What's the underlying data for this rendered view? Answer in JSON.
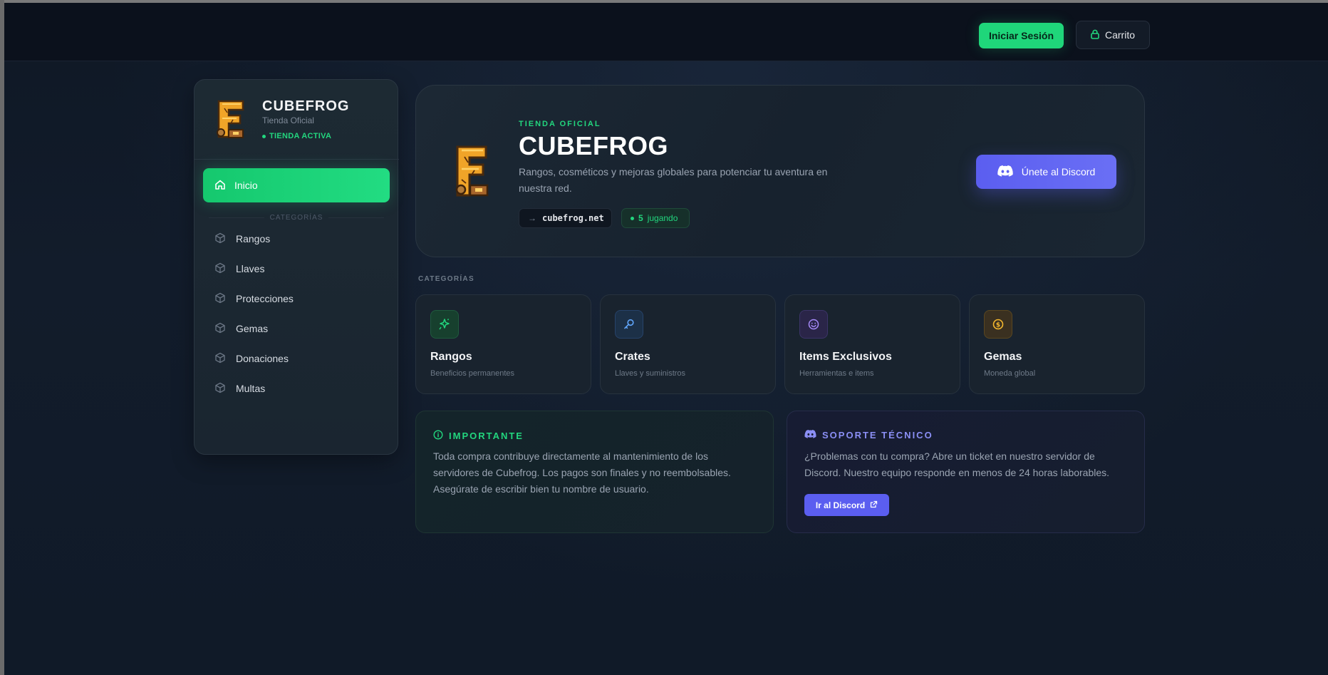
{
  "header": {
    "login_label": "Iniciar Sesión",
    "cart_label": "Carrito"
  },
  "sidebar": {
    "title": "CUBEFROG",
    "subtitle": "Tienda Oficial",
    "status": "TIENDA ACTIVA",
    "home_label": "Inicio",
    "categories_heading": "CATEGORÍAS",
    "items": [
      {
        "label": "Rangos"
      },
      {
        "label": "Llaves"
      },
      {
        "label": "Protecciones"
      },
      {
        "label": "Gemas"
      },
      {
        "label": "Donaciones"
      },
      {
        "label": "Multas"
      }
    ]
  },
  "hero": {
    "kicker": "TIENDA OFICIAL",
    "title": "CUBEFROG",
    "description": "Rangos, cosméticos y mejoras globales para potenciar tu aventura en nuestra red.",
    "domain": "cubefrog.net",
    "online_count": "5",
    "online_label": "jugando",
    "discord_label": "Únete al Discord"
  },
  "categories": {
    "heading": "CATEGORÍAS",
    "cards": [
      {
        "title": "Rangos",
        "subtitle": "Beneficios permanentes",
        "icon": "sparkle-icon",
        "color": "#22d67e"
      },
      {
        "title": "Crates",
        "subtitle": "Llaves y suministros",
        "icon": "key-icon",
        "color": "#60a5fa"
      },
      {
        "title": "Items Exclusivos",
        "subtitle": "Herramientas e items",
        "icon": "smile-icon",
        "color": "#a78bfa"
      },
      {
        "title": "Gemas",
        "subtitle": "Moneda global",
        "icon": "coin-icon",
        "color": "#f5b82e"
      }
    ]
  },
  "important": {
    "heading": "IMPORTANTE",
    "text": "Toda compra contribuye directamente al mantenimiento de los servidores de Cubefrog. Los pagos son finales y no reembolsables. Asegúrate de escribir bien tu nombre de usuario."
  },
  "support": {
    "heading": "SOPORTE TÉCNICO",
    "text": "¿Problemas con tu compra? Abre un ticket en nuestro servidor de Discord. Nuestro equipo responde en menos de 24 horas laborables.",
    "button_label": "Ir al Discord"
  },
  "colors": {
    "accent_green": "#22d67e",
    "discord": "#5b5ef0",
    "gold": "#f5b82e"
  }
}
